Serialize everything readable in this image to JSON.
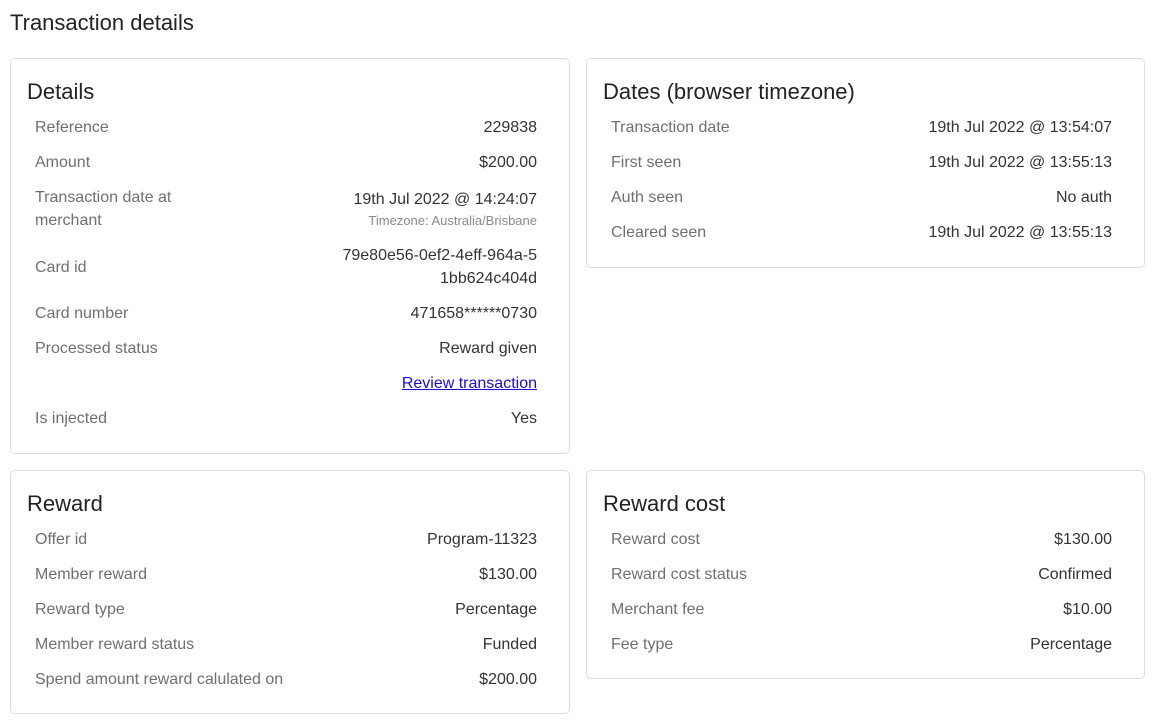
{
  "page": {
    "title": "Transaction details"
  },
  "details": {
    "title": "Details",
    "reference_label": "Reference",
    "reference_value": "229838",
    "amount_label": "Amount",
    "amount_value": "$200.00",
    "merchant_date_label": "Transaction date at merchant",
    "merchant_date_value": "19th Jul 2022 @ 14:24:07",
    "merchant_timezone": "Timezone: Australia/Brisbane",
    "card_id_label": "Card id",
    "card_id_value": "79e80e56-0ef2-4eff-964a-51bb624c404d",
    "card_number_label": "Card number",
    "card_number_value": "471658******0730",
    "processed_status_label": "Processed status",
    "processed_status_value": "Reward given",
    "review_link": "Review transaction",
    "is_injected_label": "Is injected",
    "is_injected_value": "Yes"
  },
  "dates": {
    "title": "Dates (browser timezone)",
    "transaction_date_label": "Transaction date",
    "transaction_date_value": "19th Jul 2022 @ 13:54:07",
    "first_seen_label": "First seen",
    "first_seen_value": "19th Jul 2022 @ 13:55:13",
    "auth_seen_label": "Auth seen",
    "auth_seen_value": "No auth",
    "cleared_seen_label": "Cleared seen",
    "cleared_seen_value": "19th Jul 2022 @ 13:55:13"
  },
  "reward": {
    "title": "Reward",
    "offer_id_label": "Offer id",
    "offer_id_value": "Program-11323",
    "member_reward_label": "Member reward",
    "member_reward_value": "$130.00",
    "reward_type_label": "Reward type",
    "reward_type_value": "Percentage",
    "member_reward_status_label": "Member reward status",
    "member_reward_status_value": "Funded",
    "spend_amount_label": "Spend amount reward calulated on",
    "spend_amount_value": "$200.00"
  },
  "reward_cost": {
    "title": "Reward cost",
    "reward_cost_label": "Reward cost",
    "reward_cost_value": "$130.00",
    "reward_cost_status_label": "Reward cost status",
    "reward_cost_status_value": "Confirmed",
    "merchant_fee_label": "Merchant fee",
    "merchant_fee_value": "$10.00",
    "fee_type_label": "Fee type",
    "fee_type_value": "Percentage"
  }
}
